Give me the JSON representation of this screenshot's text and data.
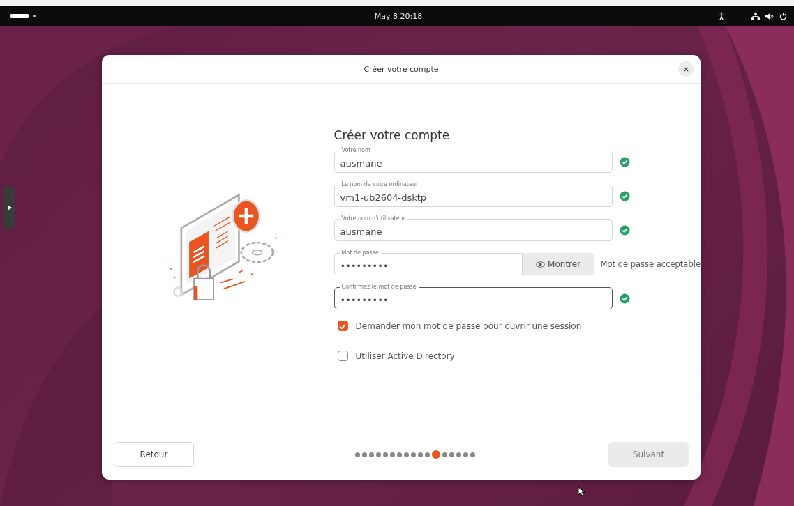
{
  "top_bar": {
    "clock": "May 8  20:18"
  },
  "window": {
    "title": "Créer votre compte"
  },
  "form": {
    "heading": "Créer votre compte",
    "fields": [
      {
        "kind": "text",
        "label": "Votre nom",
        "value": "ausmane",
        "valid": true,
        "focused": false
      },
      {
        "kind": "text",
        "label": "Le nom de votre ordinateur",
        "value": "vm1-ub2604-dsktp",
        "valid": true,
        "focused": false
      },
      {
        "kind": "text",
        "label": "Votre nom d'utilisateur",
        "value": "ausmane",
        "valid": true,
        "focused": false
      },
      {
        "kind": "password",
        "label": "Mot de passe",
        "value": "•••••••••",
        "button": "Montrer",
        "strength": "Mot de passe acceptable",
        "focused": false
      },
      {
        "kind": "text",
        "label": "Confirmez le mot de passe",
        "value": "•••••••••",
        "valid": true,
        "focused": true
      }
    ],
    "checkboxes": [
      {
        "label": "Demander mon mot de passe pour ouvrir une session",
        "checked": true
      },
      {
        "label": "Utiliser Active Directory",
        "checked": false
      }
    ]
  },
  "footer": {
    "back": "Retour",
    "next": "Suivant",
    "next_disabled": true,
    "steps": [
      {
        "selected": false
      },
      {
        "selected": false
      },
      {
        "selected": false
      },
      {
        "selected": false
      },
      {
        "selected": false
      },
      {
        "selected": false
      },
      {
        "selected": false
      },
      {
        "selected": false
      },
      {
        "selected": false
      },
      {
        "selected": false
      },
      {
        "selected": false
      },
      {
        "selected": true
      },
      {
        "selected": false
      },
      {
        "selected": false
      },
      {
        "selected": false
      },
      {
        "selected": false
      },
      {
        "selected": false
      }
    ]
  }
}
